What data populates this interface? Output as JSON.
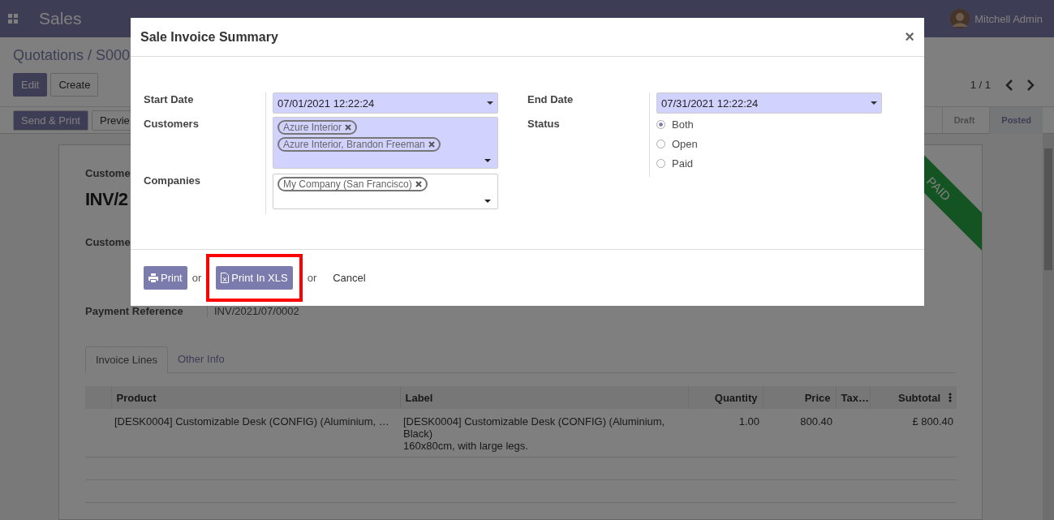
{
  "navbar": {
    "app_name": "Sales",
    "user": "Mitchell Admin"
  },
  "control_panel": {
    "breadcrumb": "Quotations / S000",
    "buttons": [
      {
        "label": "Edit",
        "kind": "primary"
      },
      {
        "label": "Create",
        "kind": "secondary"
      }
    ],
    "pager": "1 / 1"
  },
  "status_bar": {
    "buttons": [
      {
        "label": "Send & Print",
        "kind": "primary"
      },
      {
        "label": "Previe",
        "kind": "secondary"
      }
    ],
    "stages": [
      {
        "label": "Draft",
        "selected": false
      },
      {
        "label": "Posted",
        "selected": true
      }
    ]
  },
  "sheet": {
    "ribbon": "PAID",
    "customer_label": "Custome",
    "number": "INV/2",
    "customer_field_label": "Custome",
    "payment_reference_label": "Payment Reference",
    "payment_reference": "INV/2021/07/0002",
    "tabs": [
      {
        "label": "Invoice Lines",
        "selected": true
      },
      {
        "label": "Other Info",
        "selected": false
      }
    ],
    "table": {
      "columns": [
        "Product",
        "Label",
        "Quantity",
        "Price",
        "Tax…",
        "Subtotal"
      ],
      "rows": [
        {
          "cells": [
            "[DESK0004] Customizable Desk (CONFIG) (Aluminium, …",
            "[DESK0004] Customizable Desk (CONFIG) (Aluminium, Black)\n160x80cm, with large legs.",
            "1.00",
            "800.40",
            "",
            "£ 800.40"
          ]
        }
      ]
    }
  },
  "dialog": {
    "title": "Sale Invoice Summary",
    "close": "×",
    "left_fields": [
      {
        "label": "Start Date",
        "kind": "date",
        "value": "07/01/2021 12:22:24"
      },
      {
        "label": "Customers",
        "kind": "tags",
        "tags": [
          "Azure Interior",
          "Azure Interior, Brandon Freeman"
        ],
        "highlighted": true
      },
      {
        "label": "Companies",
        "kind": "tags",
        "tags": [
          "My Company (San Francisco)"
        ],
        "highlighted": false
      }
    ],
    "right_fields": [
      {
        "label": "End Date",
        "kind": "date",
        "value": "07/31/2021 12:22:24"
      },
      {
        "label": "Status",
        "kind": "radio",
        "options": [
          {
            "label": "Both",
            "selected": true
          },
          {
            "label": "Open",
            "selected": false
          },
          {
            "label": "Paid",
            "selected": false
          }
        ]
      }
    ],
    "footer": [
      {
        "kind": "print",
        "label": "Print",
        "highlighted": false
      },
      {
        "kind": "text",
        "label": "or"
      },
      {
        "kind": "xls",
        "label": "Print In XLS",
        "highlighted": true
      },
      {
        "kind": "text",
        "label": "or"
      },
      {
        "kind": "link",
        "label": "Cancel"
      }
    ]
  }
}
